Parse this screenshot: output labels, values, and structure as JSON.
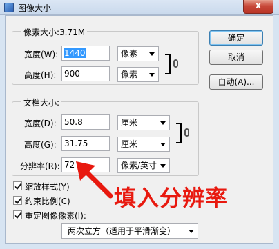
{
  "window": {
    "title": "图像大小",
    "close_glyph": "x"
  },
  "pixel_dimensions": {
    "legend": "像素大小:3.71M",
    "width": {
      "label": "宽度(W):",
      "value": "1440",
      "unit": "像素"
    },
    "height": {
      "label": "高度(H):",
      "value": "900",
      "unit": "像素"
    }
  },
  "document_size": {
    "legend": "文档大小:",
    "width": {
      "label": "宽度(D):",
      "value": "50.8",
      "unit": "厘米"
    },
    "height": {
      "label": "高度(G):",
      "value": "31.75",
      "unit": "厘米"
    },
    "resolution": {
      "label": "分辨率(R):",
      "value": "72",
      "unit": "像素/英寸"
    }
  },
  "buttons": {
    "ok": "确定",
    "cancel": "取消",
    "auto": "自动(A)..."
  },
  "options": {
    "scale_styles": {
      "label": "缩放样式(Y)",
      "checked": true
    },
    "constrain_proportions": {
      "label": "约束比例(C)",
      "checked": true
    },
    "resample": {
      "label": "重定图像像素(I):",
      "checked": true
    },
    "resample_method": "两次立方（适用于平滑渐变）"
  },
  "annotation": {
    "text": "填入分辨率",
    "color": "#e8190f"
  }
}
